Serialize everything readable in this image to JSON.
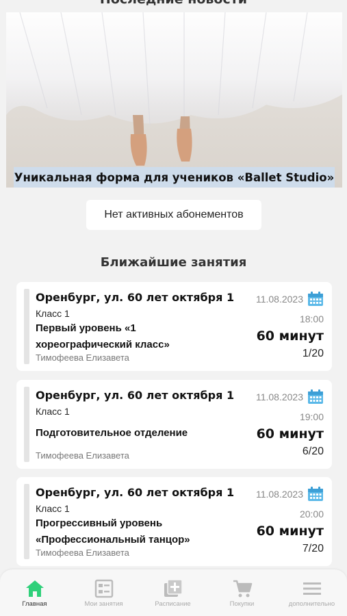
{
  "news": {
    "header": "Последние новости",
    "caption": "Уникальная форма для учеников «Ballet Studio»"
  },
  "subscriptions": {
    "empty_label": "Нет активных абонементов"
  },
  "upcoming": {
    "title": "Ближайшие занятия",
    "lessons": [
      {
        "address": "Оренбург, ул. 60 лет октября 1",
        "class": "Класс 1",
        "name": "Первый уровень «1 хореографический класс»",
        "teacher": "Тимофеева Елизавета",
        "date": "11.08.2023",
        "time": "18:00",
        "duration": "60 минут",
        "count": "1/20"
      },
      {
        "address": "Оренбург, ул. 60 лет октября 1",
        "class": "Класс 1",
        "name": "Подготовительное отделение",
        "teacher": "Тимофеева Елизавета",
        "date": "11.08.2023",
        "time": "19:00",
        "duration": "60 минут",
        "count": "6/20"
      },
      {
        "address": "Оренбург, ул. 60 лет октября 1",
        "class": "Класс 1",
        "name": "Прогрессивный уровень «Профессиональный танцор»",
        "teacher": "Тимофеева Елизавета",
        "date": "11.08.2023",
        "time": "20:00",
        "duration": "60 минут",
        "count": "7/20"
      }
    ]
  },
  "nav": {
    "items": [
      {
        "label": "Главная",
        "icon": "home-icon",
        "active": true
      },
      {
        "label": "Мои занятия",
        "icon": "my-lessons-icon",
        "active": false
      },
      {
        "label": "Расписание",
        "icon": "schedule-add-icon",
        "active": false
      },
      {
        "label": "Покупки",
        "icon": "cart-icon",
        "active": false
      },
      {
        "label": "дополнительно",
        "icon": "menu-icon",
        "active": false
      }
    ]
  },
  "colors": {
    "accent": "#2fd07a",
    "calendar": "#5ab8e8",
    "caption_bg": "#cedcec"
  }
}
